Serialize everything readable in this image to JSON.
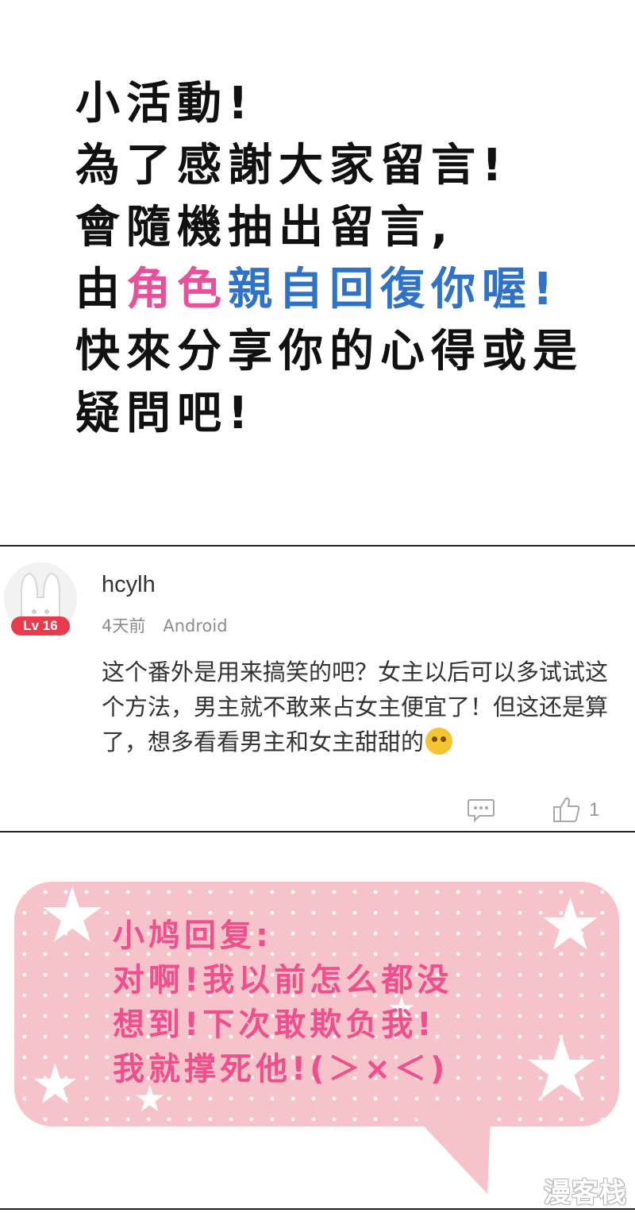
{
  "intro": {
    "line1": "小活動!",
    "line2": "為了感謝大家留言!",
    "line3": "會隨機抽出留言,",
    "line4_prefix": "由",
    "line4_pink": "角色",
    "line4_blue": "親自回復你喔!",
    "line5": "快來分享你的心得或是",
    "line6": "疑問吧!"
  },
  "comment": {
    "avatar_icon": "bunny-avatar",
    "level": "Lv 16",
    "username": "hcylh",
    "time": "4天前",
    "platform": "Android",
    "text": "这个番外是用来搞笑的吧？女主以后可以多试试这个方法，男主就不敢来占女主便宜了！但这还是算了，想多看看男主和女主甜甜的",
    "emoji_icon": "blush-emoji",
    "reply_icon": "comment-bubble-icon",
    "like_icon": "thumbs-up-icon",
    "likes": "1"
  },
  "reply": {
    "line1": "小鸠回复:",
    "line2": "对啊!我以前怎么都没",
    "line3": "想到!下次敢欺负我!",
    "line4": "我就撑死他!(＞×＜)"
  },
  "watermark": "漫客栈",
  "colors": {
    "pink_text": "#e8509a",
    "blue_text": "#2e73c9",
    "badge_red": "#ea3a4b",
    "bubble_pink": "#f6c3ca",
    "reply_pink": "#ef4f8c"
  }
}
